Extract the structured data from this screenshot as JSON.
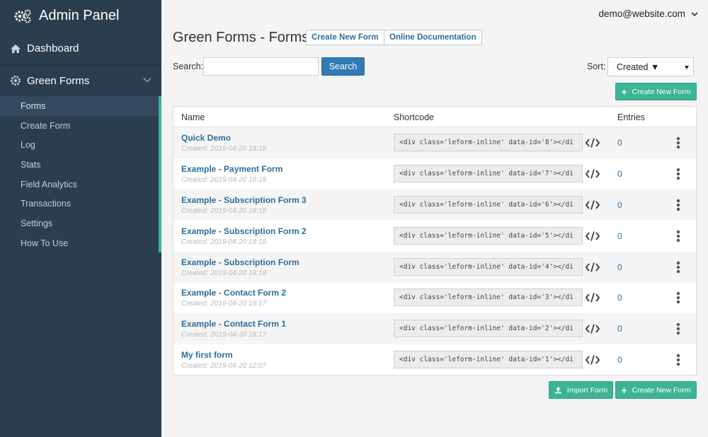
{
  "sidebar": {
    "title": "Admin Panel",
    "dashboard": "Dashboard",
    "group": "Green Forms",
    "items": [
      "Forms",
      "Create Form",
      "Log",
      "Stats",
      "Field Analytics",
      "Transactions",
      "Settings",
      "How To Use"
    ],
    "active_index": 0
  },
  "user": {
    "email": "demo@website.com"
  },
  "header": {
    "title": "Green Forms - Forms",
    "create_btn": "Create New Form",
    "docs_btn": "Online Documentation"
  },
  "search": {
    "label": "Search:",
    "value": "",
    "button": "Search"
  },
  "sort": {
    "label": "Sort:",
    "value": "Created ▼"
  },
  "actions": {
    "create_top": "Create New Form",
    "import": "Import Form",
    "create_bottom": "Create New Form"
  },
  "table": {
    "columns": [
      "Name",
      "Shortcode",
      "Entries"
    ],
    "rows": [
      {
        "name": "Quick Demo",
        "created": "Created: 2019-04-20 18:18",
        "shortcode": "<div class='leform-inline' data-id='8'></di",
        "entries": "0"
      },
      {
        "name": "Example - Payment Form",
        "created": "Created: 2019-04-20 18:18",
        "shortcode": "<div class='leform-inline' data-id='7'></di",
        "entries": "0"
      },
      {
        "name": "Example - Subscription Form 3",
        "created": "Created: 2019-04-20 18:18",
        "shortcode": "<div class='leform-inline' data-id='6'></di",
        "entries": "0"
      },
      {
        "name": "Example - Subscription Form 2",
        "created": "Created: 2019-04-20 18:18",
        "shortcode": "<div class='leform-inline' data-id='5'></di",
        "entries": "0"
      },
      {
        "name": "Example - Subscription Form",
        "created": "Created: 2019-04-20 18:18",
        "shortcode": "<div class='leform-inline' data-id='4'></di",
        "entries": "0"
      },
      {
        "name": "Example - Contact Form 2",
        "created": "Created: 2019-04-20 18:17",
        "shortcode": "<div class='leform-inline' data-id='3'></di",
        "entries": "0"
      },
      {
        "name": "Example - Contact Form 1",
        "created": "Created: 2019-04-20 18:17",
        "shortcode": "<div class='leform-inline' data-id='2'></di",
        "entries": "0"
      },
      {
        "name": "My first form",
        "created": "Created: 2019-04-20 12:07",
        "shortcode": "<div class='leform-inline' data-id='1'></di",
        "entries": "0"
      }
    ]
  },
  "colors": {
    "sidebar_bg": "#2b3e50",
    "accent_green": "#3cb594",
    "link_blue": "#2c6e9c",
    "search_btn": "#337ab7"
  }
}
